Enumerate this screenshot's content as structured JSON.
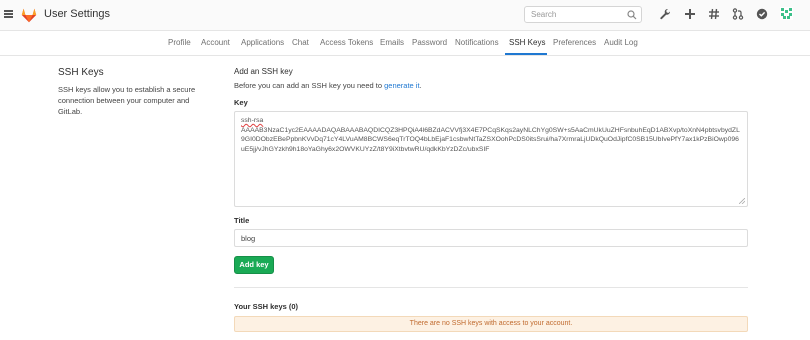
{
  "header": {
    "title": "User Settings",
    "search": {
      "placeholder": "Search"
    },
    "icons": [
      "wrench-icon",
      "plus-icon",
      "hash-icon",
      "merge-request-icon",
      "issues-icon",
      "avatar"
    ]
  },
  "tabs": [
    {
      "label": "Profile",
      "active": false
    },
    {
      "label": "Account",
      "active": false
    },
    {
      "label": "Applications",
      "active": false
    },
    {
      "label": "Chat",
      "active": false
    },
    {
      "label": "Access Tokens",
      "active": false
    },
    {
      "label": "Emails",
      "active": false
    },
    {
      "label": "Password",
      "active": false
    },
    {
      "label": "Notifications",
      "active": false
    },
    {
      "label": "SSH Keys",
      "active": true
    },
    {
      "label": "Preferences",
      "active": false
    },
    {
      "label": "Audit Log",
      "active": false
    }
  ],
  "sidebar": {
    "title": "SSH Keys",
    "description": "SSH keys allow you to establish a secure connection between your computer and GitLab."
  },
  "form": {
    "heading": "Add an SSH key",
    "intro_prefix": "Before you can add an SSH key you need to ",
    "intro_link": "generate it",
    "intro_suffix": ".",
    "key_label": "Key",
    "key_type": "ssh-rsa",
    "key_body": "AAAAB3NzaC1yc2EAAAADAQABAAABAQDICQZ3HPQiA4l6BZdACVVfj3X4E7PCqSKqs2ayNLChYg0SW+s5AaCmUkUuZHFsnbuhEqD1ABXvp/toXnN4pbtsvbydZL9GI0DObzEBePpbnKVvDq71cY4LVuAM8BCWS6eqTrTOQ4bLbEjaF1csbwNtTaZSXOohPcDS0itsSrui/ha7XrmraLjUDkQuOdJipfC0SB15UbIvePfY7ax1kPzBiOwp096uE5jj/vJhGYzkh9h18oYaGhy6x2OWVKUYzZ/t8Y9iXtbvtwRU/qdkKbYzDZc/ubxSIF",
    "title_label": "Title",
    "title_value": "blog",
    "submit_label": "Add key"
  },
  "keys": {
    "heading": "Your SSH keys (0)",
    "empty_message": "There are no SSH keys with access to your account."
  },
  "colors": {
    "accent": "#1f78d1",
    "success": "#1aaa55",
    "warning_bg": "#fdf1e3",
    "warning_text": "#c06a2e",
    "logo": "#e24329"
  }
}
